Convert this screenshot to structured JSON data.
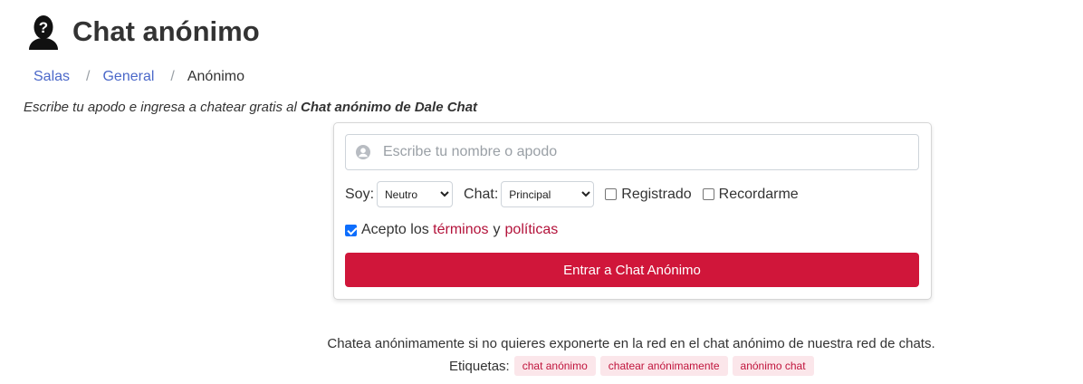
{
  "page": {
    "title": "Chat anónimo",
    "intro_prefix": "Escribe tu apodo e ingresa a chatear gratis al ",
    "intro_bold": "Chat anónimo de Dale Chat"
  },
  "breadcrumb": {
    "items": [
      "Salas",
      "General"
    ],
    "separator": "/",
    "current": "Anónimo"
  },
  "form": {
    "name_placeholder": "Escribe tu nombre o apodo",
    "soy_label": "Soy:",
    "soy_value": "Neutro",
    "chat_label": "Chat:",
    "chat_value": "Principal",
    "registrado_label": "Registrado",
    "registrado_checked": false,
    "recordarme_label": "Recordarme",
    "recordarme_checked": false,
    "accept_prefix": "Acepto los",
    "terms_link": "términos",
    "conj": "y",
    "policies_link": "políticas",
    "accept_checked": true,
    "submit_label": "Entrar a Chat Anónimo"
  },
  "footer": {
    "description": "Chatea anónimamente si no quieres exponerte en la red en el chat anónimo de nuestra red de chats.",
    "tags_label": "Etiquetas:",
    "tags": [
      "chat anónimo",
      "chatear anónimamente",
      "anónimo chat"
    ]
  },
  "colors": {
    "primary_red": "#d0163a",
    "link_blue": "#4b68c9",
    "link_red": "#b3123a",
    "tag_bg": "#fbe6ea"
  },
  "icons": {
    "logo": "anonymous-person-icon",
    "name_field": "user-circle-icon"
  }
}
